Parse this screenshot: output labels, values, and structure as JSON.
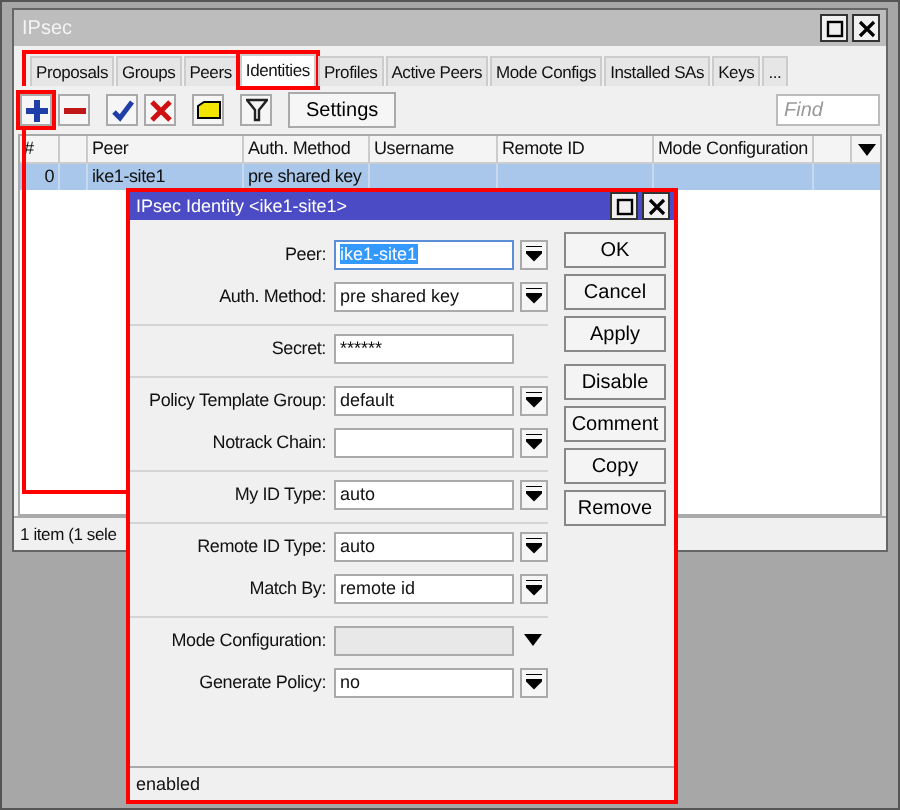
{
  "window": {
    "title": "IPsec"
  },
  "tabs": [
    {
      "label": "Proposals",
      "selected": false,
      "annotated": false
    },
    {
      "label": "Groups",
      "selected": false,
      "annotated": false
    },
    {
      "label": "Peers",
      "selected": false,
      "annotated": false
    },
    {
      "label": "Identities",
      "selected": true,
      "annotated": true
    },
    {
      "label": "Profiles",
      "selected": false,
      "annotated": false
    },
    {
      "label": "Active Peers",
      "selected": false,
      "annotated": false
    },
    {
      "label": "Mode Configs",
      "selected": false,
      "annotated": false
    },
    {
      "label": "Installed SAs",
      "selected": false,
      "annotated": false
    },
    {
      "label": "Keys",
      "selected": false,
      "annotated": false
    },
    {
      "label": "...",
      "selected": false,
      "annotated": false
    }
  ],
  "toolbar": {
    "buttons": [
      {
        "kind": "add",
        "annotated": true
      },
      {
        "kind": "remove",
        "annotated": false
      },
      {
        "kind": "enable",
        "annotated": false
      },
      {
        "kind": "disable",
        "annotated": false
      },
      {
        "kind": "comment",
        "annotated": false
      },
      {
        "kind": "filter",
        "annotated": false
      }
    ],
    "settings_label": "Settings",
    "find_placeholder": "Find"
  },
  "table": {
    "columns": [
      "#",
      "Peer",
      "Auth. Method",
      "Username",
      "Remote ID",
      "Mode Configuration"
    ],
    "rows": [
      {
        "cells": [
          "0",
          "ike1-site1",
          "pre shared key",
          "",
          "",
          ""
        ],
        "selected": true
      }
    ]
  },
  "status_bar": "1 item (1 sele",
  "dialog": {
    "title": "IPsec Identity <ike1-site1>",
    "annotated": true,
    "groups": [
      [
        {
          "label": "Peer:",
          "value": "ike1-site1",
          "kind": "select",
          "text_selected": true,
          "disabled": false
        },
        {
          "label": "Auth. Method:",
          "value": "pre shared key",
          "kind": "select",
          "text_selected": false,
          "disabled": false
        }
      ],
      [
        {
          "label": "Secret:",
          "value": "******",
          "kind": "text",
          "text_selected": false,
          "disabled": false
        }
      ],
      [
        {
          "label": "Policy Template Group:",
          "value": "default",
          "kind": "select",
          "text_selected": false,
          "disabled": false
        },
        {
          "label": "Notrack Chain:",
          "kind": "select",
          "text_selected": false,
          "disabled": false
        }
      ],
      [
        {
          "label": "My ID Type:",
          "value": "auto",
          "kind": "select",
          "text_selected": false,
          "disabled": false
        }
      ],
      [
        {
          "label": "Remote ID Type:",
          "value": "auto",
          "kind": "select",
          "text_selected": false,
          "disabled": false
        },
        {
          "label": "Match By:",
          "value": "remote id",
          "kind": "select",
          "text_selected": false,
          "disabled": false
        }
      ],
      [
        {
          "label": "Mode Configuration:",
          "kind": "select",
          "text_selected": false,
          "disabled": true
        },
        {
          "label": "Generate Policy:",
          "value": "no",
          "kind": "select",
          "text_selected": false,
          "disabled": false
        }
      ]
    ],
    "buttons": [
      [
        "OK",
        "Cancel",
        "Apply"
      ],
      [
        "Disable",
        "Comment",
        "Copy",
        "Remove"
      ]
    ],
    "status": "enabled"
  }
}
